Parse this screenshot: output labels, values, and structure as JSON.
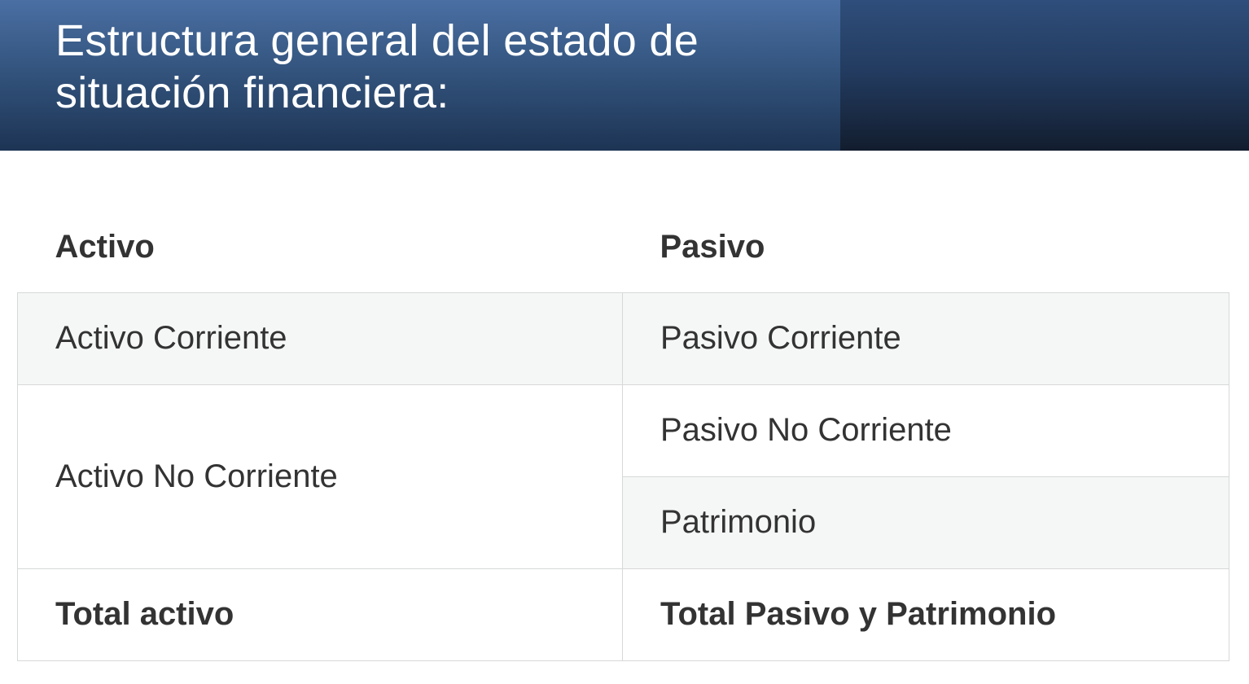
{
  "header": {
    "title_line1": "Estructura general del estado de",
    "title_line2": "situación financiera:"
  },
  "table": {
    "headers": [
      "Activo",
      "Pasivo"
    ],
    "rows": {
      "activo_corriente": "Activo Corriente",
      "pasivo_corriente": "Pasivo Corriente",
      "activo_no_corriente": "Activo No Corriente",
      "pasivo_no_corriente": "Pasivo No Corriente",
      "patrimonio": "Patrimonio",
      "total_activo": "Total activo",
      "total_pasivo_patrimonio": "Total Pasivo y Patrimonio"
    }
  },
  "colors": {
    "header_blue": "#34557f",
    "row_shade": "#f5f7f6",
    "text": "#333333"
  }
}
